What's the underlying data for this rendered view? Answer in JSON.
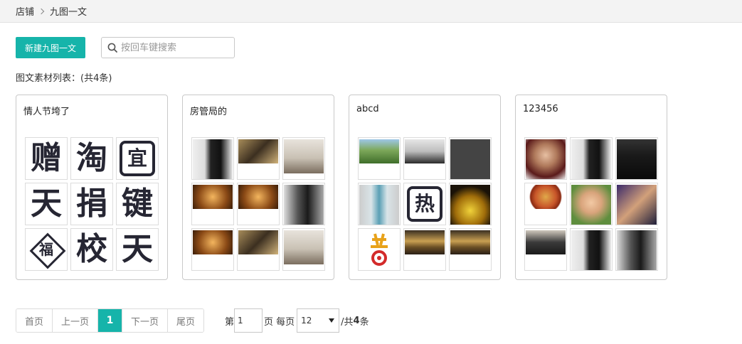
{
  "breadcrumb": {
    "root": "店铺",
    "current": "九图一文"
  },
  "toolbar": {
    "new_label": "新建九图一文",
    "search_placeholder": "按回车键搜索"
  },
  "list": {
    "title": "图文素材列表：(共4条)"
  },
  "cards": [
    {
      "title": "情人节垮了",
      "glyphs": [
        "赠",
        "淘",
        "宜",
        "天",
        "捐",
        "键",
        "福",
        "校",
        "天"
      ]
    },
    {
      "title": "房管局的"
    },
    {
      "title": "abcd",
      "glyphs": [
        "热"
      ]
    },
    {
      "title": "123456"
    }
  ],
  "pagination": {
    "first": "首页",
    "prev": "上一页",
    "current": "1",
    "next": "下一页",
    "last": "尾页",
    "page_prefix": "第",
    "page_value": "1",
    "page_suffix": "页 每页",
    "per_page": "12",
    "total_prefix": "/共",
    "total_count": "4",
    "total_suffix": "条"
  },
  "colors": {
    "accent": "#16b4aa",
    "glyph": "#262633"
  }
}
